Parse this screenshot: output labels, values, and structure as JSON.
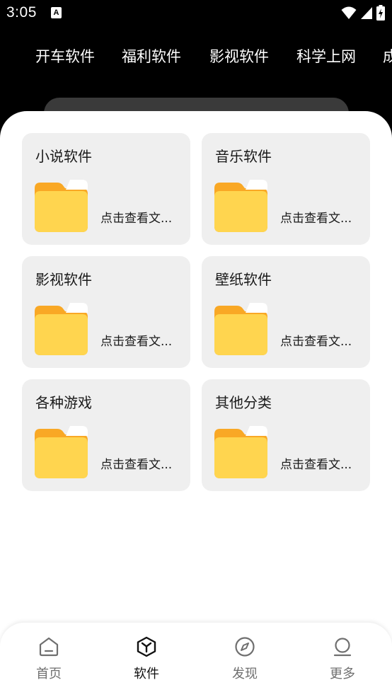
{
  "status_bar": {
    "time": "3:05",
    "notification_icon": "a-letter-icon",
    "icons": [
      "wifi-icon",
      "cell-signal-icon",
      "battery-charging-icon"
    ]
  },
  "top_tabs": [
    "开车软件",
    "福利软件",
    "影视软件",
    "科学上网",
    "成"
  ],
  "cards": [
    {
      "title": "小说软件",
      "hint": "点击查看文..."
    },
    {
      "title": "音乐软件",
      "hint": "点击查看文..."
    },
    {
      "title": "影视软件",
      "hint": "点击查看文..."
    },
    {
      "title": "壁纸软件",
      "hint": "点击查看文..."
    },
    {
      "title": "各种游戏",
      "hint": "点击查看文..."
    },
    {
      "title": "其他分类",
      "hint": "点击查看文..."
    }
  ],
  "bottom_nav": [
    {
      "label": "首页",
      "icon": "home-icon",
      "active": false
    },
    {
      "label": "软件",
      "icon": "cube-icon",
      "active": true
    },
    {
      "label": "发现",
      "icon": "compass-icon",
      "active": false
    },
    {
      "label": "更多",
      "icon": "person-icon",
      "active": false
    }
  ],
  "colors": {
    "background_dark": "#000000",
    "card_bg": "#efefef",
    "folder_front": "#ffd54f",
    "folder_back": "#f9a825"
  }
}
